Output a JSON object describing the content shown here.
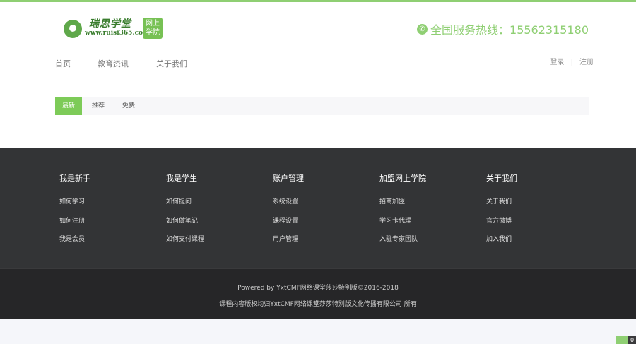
{
  "brand": {
    "title": "瑞思学堂",
    "url": "www.ruisi365.com",
    "badge": "网上学院",
    "hotline": "全国服务热线：15562315180"
  },
  "nav": {
    "items": [
      "首页",
      "教育资讯",
      "关于我们"
    ],
    "login": "登录",
    "separator": "|",
    "register": "注册"
  },
  "tabs": {
    "items": [
      "最新",
      "推荐",
      "免费"
    ],
    "active": "最新"
  },
  "footer": {
    "columns": [
      {
        "title": "我是新手",
        "links": [
          "如何学习",
          "如何注册",
          "我是会员"
        ]
      },
      {
        "title": "我是学生",
        "links": [
          "如何提问",
          "如何做笔记",
          "如何支付课程"
        ]
      },
      {
        "title": "账户管理",
        "links": [
          "系统设置",
          "课程设置",
          "用户管理"
        ]
      },
      {
        "title": "加盟网上学院",
        "links": [
          "招商加盟",
          "学习卡代理",
          "入驻专家团队"
        ]
      },
      {
        "title": "关于我们",
        "links": [
          "关于我们",
          "官方微博",
          "加入我们"
        ]
      }
    ],
    "powered": "Powered by YxtCMF网络课堂莎莎特别版©2016-2018",
    "copyright": "课程内容版权均归YxtCMF网络课堂莎莎特别版文化传播有限公司 所有"
  },
  "float_button": {
    "label": "0"
  },
  "colors": {
    "accent": "#8fcf73",
    "footer_bg": "#333436",
    "footer_bottom_bg": "#262628"
  }
}
